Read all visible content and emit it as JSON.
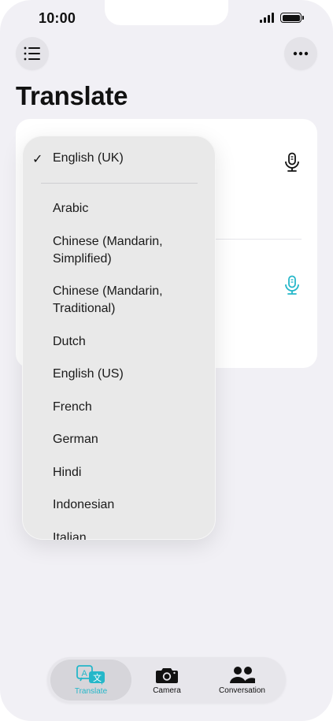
{
  "status": {
    "time": "10:00"
  },
  "header": {
    "title": "Translate"
  },
  "dropdown": {
    "selected": "English (UK)",
    "check": "✓",
    "items": [
      "Arabic",
      "Chinese (Mandarin, Simplified)",
      "Chinese (Mandarin, Traditional)",
      "Dutch",
      "English (US)",
      "French",
      "German",
      "Hindi",
      "Indonesian",
      "Italian"
    ]
  },
  "tabs": [
    {
      "label": "Translate",
      "icon": "translate-icon",
      "active": true
    },
    {
      "label": "Camera",
      "icon": "camera-icon",
      "active": false
    },
    {
      "label": "Conversation",
      "icon": "people-icon",
      "active": false
    }
  ],
  "colors": {
    "accent": "#25b7c9",
    "background": "#f1f0f5",
    "card": "#ffffff"
  }
}
